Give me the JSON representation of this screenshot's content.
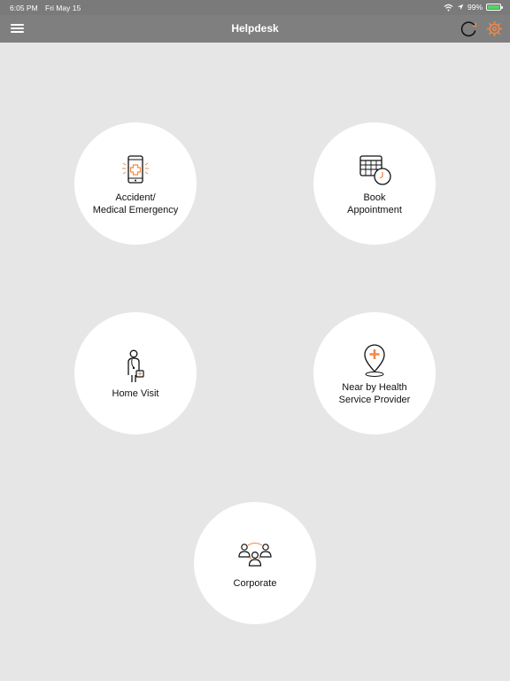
{
  "status_bar": {
    "time": "6:05 PM",
    "date": "Fri May 15",
    "battery": "99%",
    "icons": [
      "wifi-icon",
      "location-icon",
      "battery-icon"
    ]
  },
  "app_bar": {
    "title": "Helpdesk",
    "icons": [
      "menu-icon",
      "refresh-icon",
      "gear-icon"
    ],
    "accent_color": "#f08a4b"
  },
  "tiles": [
    {
      "label": "Accident/\nMedical Emergency",
      "icon": "medical-phone-icon"
    },
    {
      "label": "Book\nAppointment",
      "icon": "calendar-clock-icon"
    },
    {
      "label": "Home Visit",
      "icon": "doctor-icon"
    },
    {
      "label": "Near by Health\nService Provider",
      "icon": "location-pin-cross-icon"
    },
    {
      "label": "Corporate",
      "icon": "group-icon"
    }
  ],
  "colors": {
    "background": "#e6e6e6",
    "app_bar": "#7f7f7f",
    "tile": "#ffffff",
    "accent": "#f08a4b"
  }
}
